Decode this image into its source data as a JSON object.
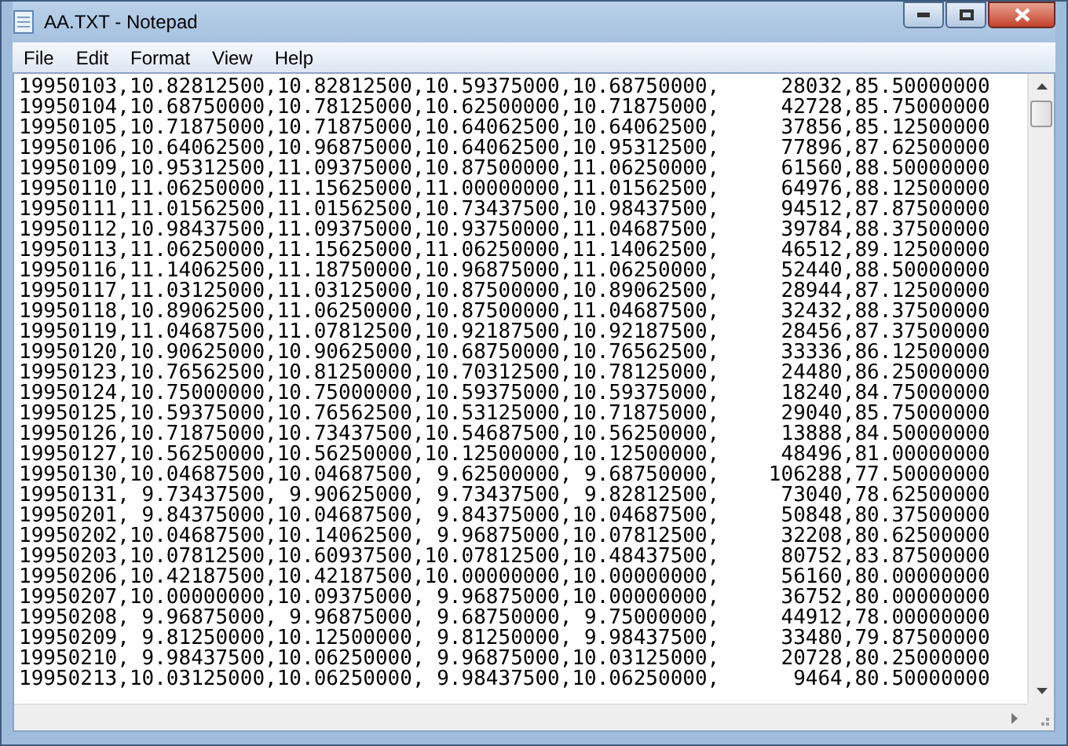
{
  "window": {
    "title": "AA.TXT - Notepad"
  },
  "menu": [
    "File",
    "Edit",
    "Format",
    "View",
    "Help"
  ],
  "lines": [
    "19950103,10.82812500,10.82812500,10.59375000,10.68750000,     28032,85.50000000",
    "19950104,10.68750000,10.78125000,10.62500000,10.71875000,     42728,85.75000000",
    "19950105,10.71875000,10.71875000,10.64062500,10.64062500,     37856,85.12500000",
    "19950106,10.64062500,10.96875000,10.64062500,10.95312500,     77896,87.62500000",
    "19950109,10.95312500,11.09375000,10.87500000,11.06250000,     61560,88.50000000",
    "19950110,11.06250000,11.15625000,11.00000000,11.01562500,     64976,88.12500000",
    "19950111,11.01562500,11.01562500,10.73437500,10.98437500,     94512,87.87500000",
    "19950112,10.98437500,11.09375000,10.93750000,11.04687500,     39784,88.37500000",
    "19950113,11.06250000,11.15625000,11.06250000,11.14062500,     46512,89.12500000",
    "19950116,11.14062500,11.18750000,10.96875000,11.06250000,     52440,88.50000000",
    "19950117,11.03125000,11.03125000,10.87500000,10.89062500,     28944,87.12500000",
    "19950118,10.89062500,11.06250000,10.87500000,11.04687500,     32432,88.37500000",
    "19950119,11.04687500,11.07812500,10.92187500,10.92187500,     28456,87.37500000",
    "19950120,10.90625000,10.90625000,10.68750000,10.76562500,     33336,86.12500000",
    "19950123,10.76562500,10.81250000,10.70312500,10.78125000,     24480,86.25000000",
    "19950124,10.75000000,10.75000000,10.59375000,10.59375000,     18240,84.75000000",
    "19950125,10.59375000,10.76562500,10.53125000,10.71875000,     29040,85.75000000",
    "19950126,10.71875000,10.73437500,10.54687500,10.56250000,     13888,84.50000000",
    "19950127,10.56250000,10.56250000,10.12500000,10.12500000,     48496,81.00000000",
    "19950130,10.04687500,10.04687500, 9.62500000, 9.68750000,    106288,77.50000000",
    "19950131, 9.73437500, 9.90625000, 9.73437500, 9.82812500,     73040,78.62500000",
    "19950201, 9.84375000,10.04687500, 9.84375000,10.04687500,     50848,80.37500000",
    "19950202,10.04687500,10.14062500, 9.96875000,10.07812500,     32208,80.62500000",
    "19950203,10.07812500,10.60937500,10.07812500,10.48437500,     80752,83.87500000",
    "19950206,10.42187500,10.42187500,10.00000000,10.00000000,     56160,80.00000000",
    "19950207,10.00000000,10.09375000, 9.96875000,10.00000000,     36752,80.00000000",
    "19950208, 9.96875000, 9.96875000, 9.68750000, 9.75000000,     44912,78.00000000",
    "19950209, 9.81250000,10.12500000, 9.81250000, 9.98437500,     33480,79.87500000",
    "19950210, 9.98437500,10.06250000, 9.96875000,10.03125000,     20728,80.25000000",
    "19950213,10.03125000,10.06250000, 9.98437500,10.06250000,      9464,80.50000000"
  ]
}
